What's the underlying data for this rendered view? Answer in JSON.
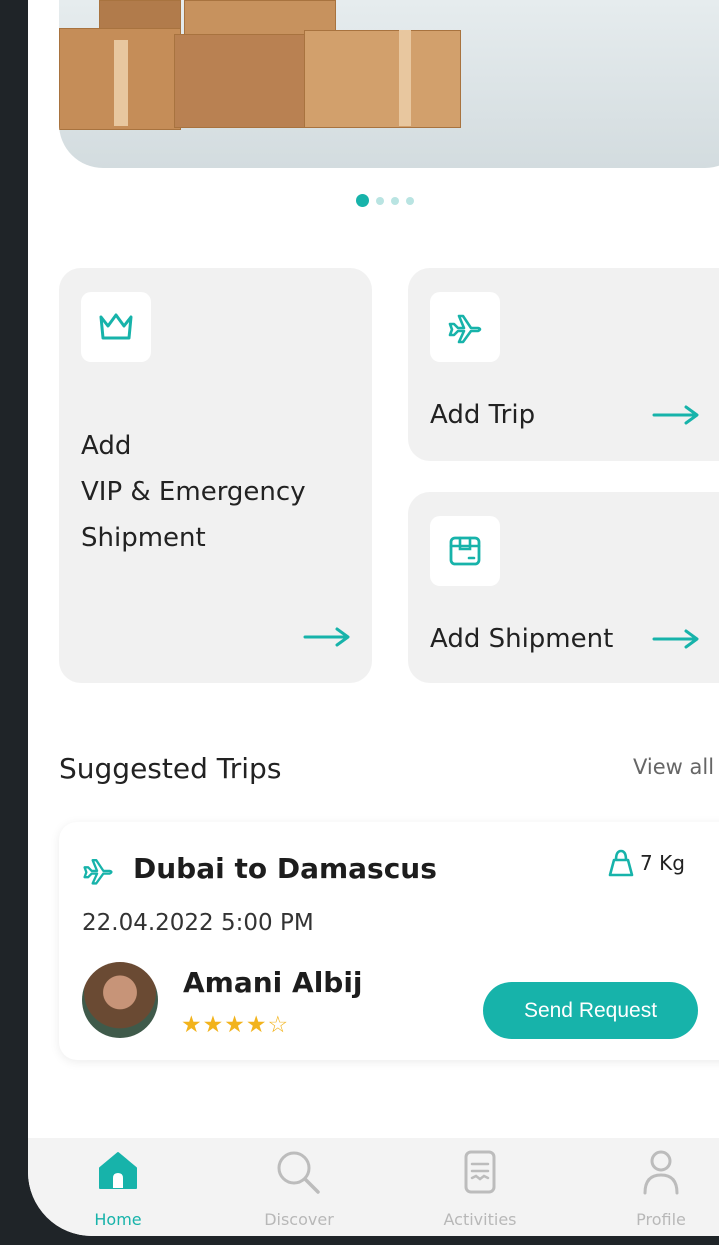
{
  "colors": {
    "accent": "#17b3aa",
    "star": "#f2b31c",
    "card_bg": "#f1f1f1",
    "text": "#222222"
  },
  "carousel": {
    "slides": 4,
    "active_index": 0
  },
  "actions": {
    "vip": {
      "label_line1": "Add",
      "label_line2": "VIP & Emergency",
      "label_line3": "Shipment",
      "icon": "crown-icon"
    },
    "trip": {
      "label": "Add Trip",
      "icon": "airplane-icon"
    },
    "shipment": {
      "label": "Add Shipment",
      "icon": "package-icon"
    }
  },
  "suggested": {
    "title": "Suggested Trips",
    "view_all": "View all",
    "trip": {
      "route": "Dubai to Damascus",
      "weight": "7 Kg",
      "datetime": "22.04.2022  5:00 PM",
      "traveler_name": "Amani Albij",
      "stars": "★★★★☆",
      "rating": 4,
      "cta": "Send Request"
    }
  },
  "nav": [
    {
      "label": "Home",
      "icon": "home-icon",
      "active": true
    },
    {
      "label": "Discover",
      "icon": "search-icon",
      "active": false
    },
    {
      "label": "Activities",
      "icon": "document-icon",
      "active": false
    },
    {
      "label": "Profile",
      "icon": "user-icon",
      "active": false
    }
  ]
}
